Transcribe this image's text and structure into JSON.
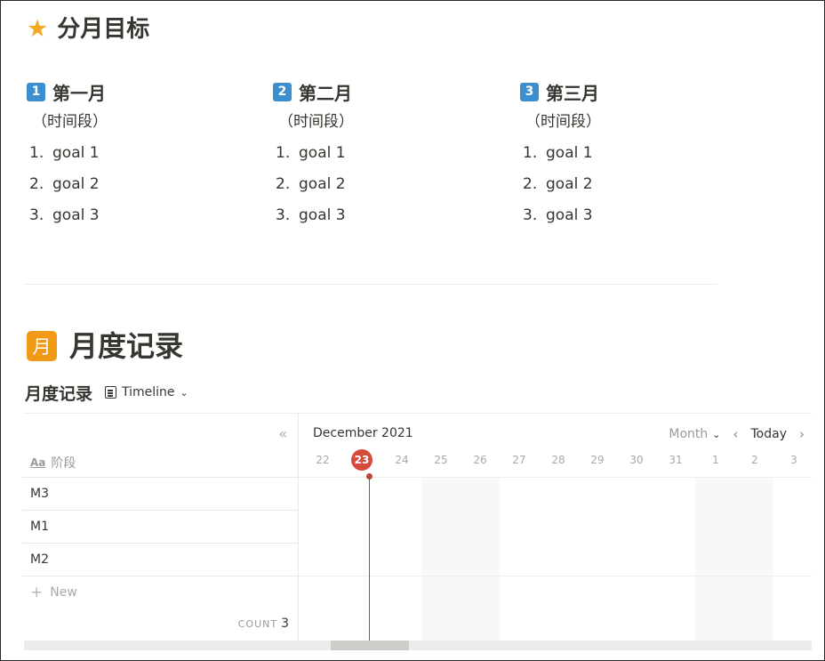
{
  "page": {
    "heading1": "分月目标",
    "heading1_icon": "star-icon",
    "columns": [
      {
        "badge": "1",
        "title": "第一月",
        "period": "（时间段）",
        "goals": [
          {
            "n": "1.",
            "text": "goal 1"
          },
          {
            "n": "2.",
            "text": "goal 2"
          },
          {
            "n": "3.",
            "text": "goal 3"
          }
        ]
      },
      {
        "badge": "2",
        "title": "第二月",
        "period": "（时间段）",
        "goals": [
          {
            "n": "1.",
            "text": "goal 1"
          },
          {
            "n": "2.",
            "text": "goal 2"
          },
          {
            "n": "3.",
            "text": "goal 3"
          }
        ]
      },
      {
        "badge": "3",
        "title": "第三月",
        "period": "（时间段）",
        "goals": [
          {
            "n": "1.",
            "text": "goal 1"
          },
          {
            "n": "2.",
            "text": "goal 2"
          },
          {
            "n": "3.",
            "text": "goal 3"
          }
        ]
      }
    ],
    "heading2_icon_char": "月",
    "heading2": "月度记录"
  },
  "database": {
    "title": "月度记录",
    "view_label": "Timeline",
    "property_icon": "Aa",
    "property_name": "阶段",
    "rows": [
      "M3",
      "M1",
      "M2"
    ],
    "new_label": "New",
    "count_label": "COUNT",
    "count_value": "3"
  },
  "timeline": {
    "month_label": "December 2021",
    "scale_label": "Month",
    "today_label": "Today",
    "days": [
      "22",
      "23",
      "24",
      "25",
      "26",
      "27",
      "28",
      "29",
      "30",
      "31",
      "1",
      "2",
      "3"
    ],
    "current_day": "23"
  },
  "colors": {
    "star": "#f5a623",
    "badge": "#3b8ed0",
    "month_icon": "#f09a18",
    "today_marker": "#d64c3c"
  }
}
